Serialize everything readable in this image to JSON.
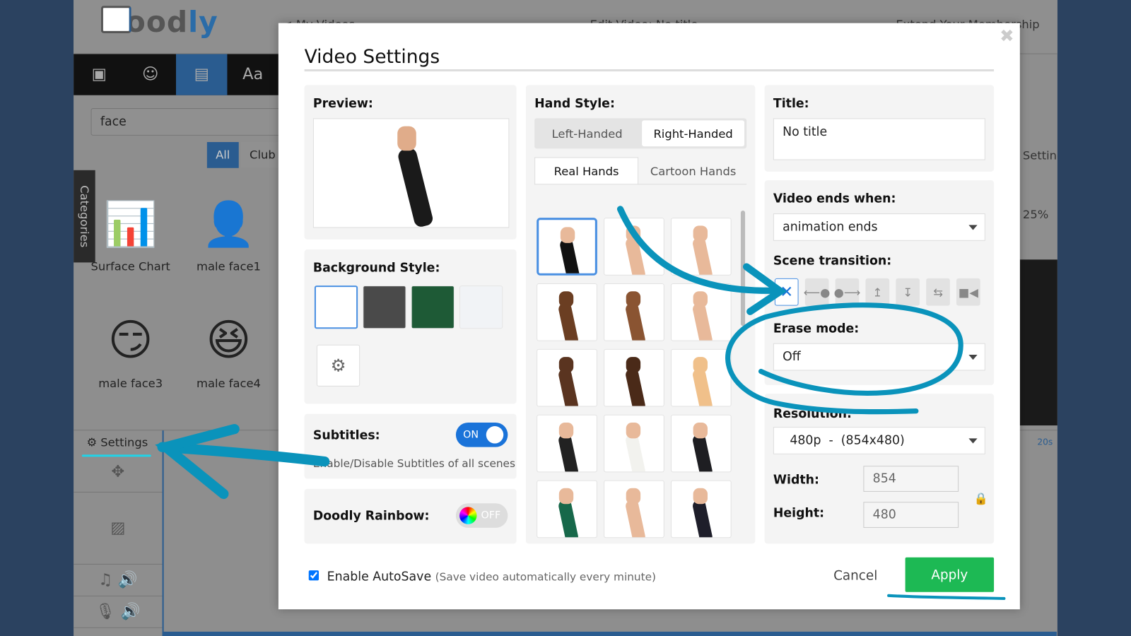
{
  "app": {
    "logo": "Doodly",
    "breadcrumb": "< My Videos",
    "header_title": "Edit Video: No title",
    "header_right": "Extend Your Membership",
    "toolbar_icons": [
      "image-icon",
      "characters-icon",
      "props-icon",
      "text-icon"
    ],
    "search_value": "face",
    "filters": [
      "All",
      "Club"
    ],
    "categories_tab": "Categories",
    "assets": [
      "Surface Chart",
      "male face1",
      "male face3",
      "male face4"
    ],
    "settings_label": "Settings",
    "zoom_pct": "25%",
    "timeline_mark": "20s",
    "right_settings": "Setting"
  },
  "modal": {
    "title": "Video Settings",
    "preview_label": "Preview:",
    "background_label": "Background Style:",
    "background_swatches": [
      "#ffffff",
      "#4a4a4a",
      "#1e5a36",
      "#f1f3f6"
    ],
    "subtitles_label": "Subtitles:",
    "subtitles_state": "ON",
    "subtitles_desc": "Enable/Disable Subtitles of all scenes",
    "rainbow_label": "Doodly Rainbow:",
    "rainbow_state": "OFF",
    "hand_style_label": "Hand Style:",
    "hand_side": [
      "Left-Handed",
      "Right-Handed"
    ],
    "hand_side_selected": "Right-Handed",
    "hand_type": [
      "Real Hands",
      "Cartoon Hands"
    ],
    "hand_type_selected": "Real Hands",
    "hands": [
      [
        "#111",
        "#e8b99a"
      ],
      [
        "#e8b99a",
        "#e8b99a"
      ],
      [
        "#e8b99a",
        "#e8b99a"
      ],
      [
        "#6b3e22",
        "#6b3e22"
      ],
      [
        "#8a5432",
        "#8a5432"
      ],
      [
        "#e8b99a",
        "#e8b99a"
      ],
      [
        "#5a3420",
        "#5a3420"
      ],
      [
        "#4a2a18",
        "#4a2a18"
      ],
      [
        "#f0c08a",
        "#f0c08a"
      ],
      [
        "#222",
        "#e8b99a"
      ],
      [
        "#f2f2ee",
        "#e8b99a"
      ],
      [
        "#1e1e22",
        "#e8b99a"
      ],
      [
        "#17684a",
        "#e8b99a"
      ],
      [
        "#e8b99a",
        "#e8b99a"
      ],
      [
        "#1e1e2a",
        "#e8b99a"
      ]
    ],
    "title_label": "Title:",
    "title_value": "No title",
    "ends_label": "Video ends when:",
    "ends_value": "animation ends",
    "transition_label": "Scene transition:",
    "transitions": [
      "none",
      "slide-left",
      "slide-right",
      "slide-up",
      "slide-down",
      "swap",
      "camera"
    ],
    "transition_selected": "none",
    "erase_label": "Erase mode:",
    "erase_value": "Off",
    "resolution_label": "Resolution:",
    "resolution_value": "480p  -  (854x480)",
    "width_label": "Width:",
    "width_value": "854",
    "height_label": "Height:",
    "height_value": "480",
    "autosave_label": "Enable AutoSave",
    "autosave_desc": "(Save video automatically every minute)",
    "autosave_checked": true,
    "cancel": "Cancel",
    "apply": "Apply",
    "apply_color": "#1db954",
    "annotation_color": "#0a93bb"
  }
}
